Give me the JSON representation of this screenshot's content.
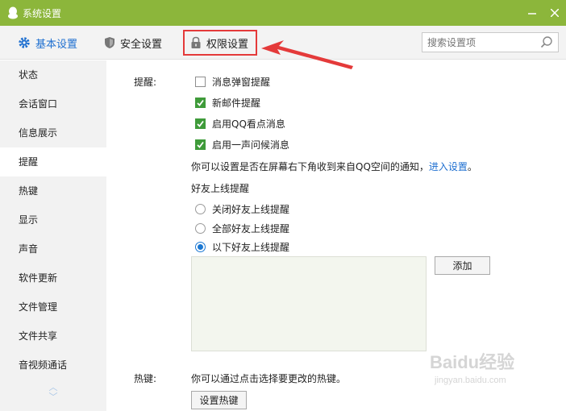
{
  "window": {
    "title": "系统设置"
  },
  "tabs": [
    {
      "label": "基本设置",
      "icon": "gear-icon",
      "active": true
    },
    {
      "label": "安全设置",
      "icon": "shield-icon",
      "active": false
    },
    {
      "label": "权限设置",
      "icon": "lock-icon",
      "active": false
    }
  ],
  "search": {
    "placeholder": "搜索设置项"
  },
  "sidebar": {
    "items": [
      {
        "label": "状态"
      },
      {
        "label": "会话窗口"
      },
      {
        "label": "信息展示"
      },
      {
        "label": "提醒",
        "active": true
      },
      {
        "label": "热键"
      },
      {
        "label": "显示"
      },
      {
        "label": "声音"
      },
      {
        "label": "软件更新"
      },
      {
        "label": "文件管理"
      },
      {
        "label": "文件共享"
      },
      {
        "label": "音视频通话"
      }
    ]
  },
  "reminders": {
    "section_label": "提醒:",
    "checkboxes": [
      {
        "label": "消息弹窗提醒",
        "checked": false
      },
      {
        "label": "新邮件提醒",
        "checked": true
      },
      {
        "label": "启用QQ看点消息",
        "checked": true
      },
      {
        "label": "启用一声问候消息",
        "checked": true
      }
    ],
    "qzone_note": "你可以设置是否在屏幕右下角收到来自QQ空间的通知，",
    "qzone_link": "进入设置",
    "qzone_period": "。",
    "friend_online_title": "好友上线提醒",
    "radios": [
      {
        "label": "关闭好友上线提醒",
        "checked": false
      },
      {
        "label": "全部好友上线提醒",
        "checked": false
      },
      {
        "label": "以下好友上线提醒",
        "checked": true
      }
    ],
    "add_button": "添加"
  },
  "hotkeys": {
    "section_label": "热键:",
    "note": "你可以通过点击选择要更改的热键。",
    "set_button": "设置热键"
  },
  "watermark": {
    "text": "Baidu经验",
    "sub": "jingyan.baidu.com"
  },
  "colors": {
    "titlebar": "#8cb63b",
    "accent": "#1e6fd0",
    "highlight_red": "#e43a3a",
    "checkbox_green": "#3f9b3a"
  }
}
